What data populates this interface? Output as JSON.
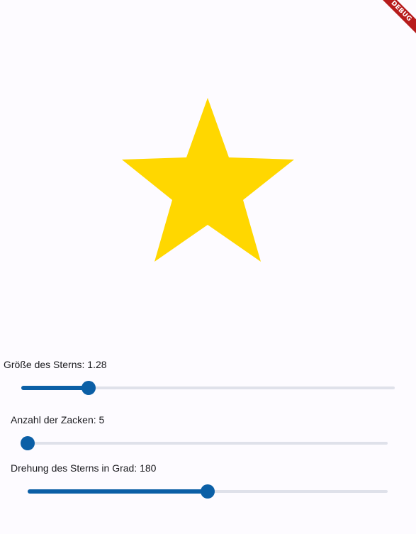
{
  "debug_banner": {
    "label": "DEBUG",
    "color": "#b71c1c"
  },
  "star": {
    "fill": "#ffd700",
    "size": 1.28,
    "points": 5,
    "rotation_degrees": 180
  },
  "sliders": [
    {
      "label": "Größe des Sterns: ",
      "value_text": "1.28",
      "fraction": 0.18
    },
    {
      "label": "Anzahl der Zacken: ",
      "value_text": "5",
      "fraction": 0.0
    },
    {
      "label": "Drehung des Sterns in Grad: ",
      "value_text": "180",
      "fraction": 0.5
    }
  ],
  "colors": {
    "accent": "#0b5fa6",
    "track_inactive": "#dfe1ea",
    "background": "#fdfbff"
  }
}
